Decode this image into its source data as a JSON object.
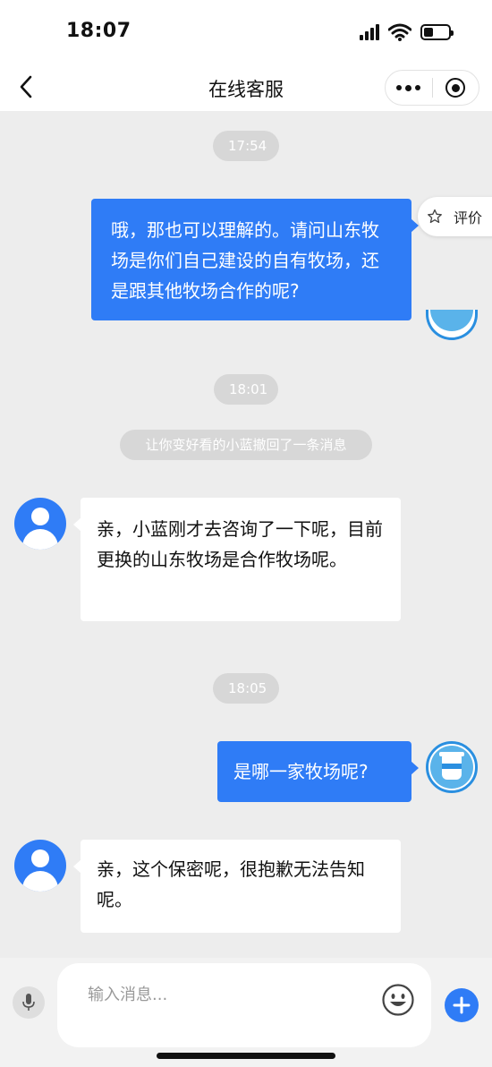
{
  "status": {
    "time": "18:07"
  },
  "nav": {
    "title": "在线客服"
  },
  "rate": {
    "label": "评价"
  },
  "messages": {
    "t1": "17:54",
    "m1": "哦，那也可以理解的。请问山东牧场是你们自己建设的自有牧场，还是跟其他牧场合作的呢?",
    "t2": "18:01",
    "notice": "让你变好看的小蓝撤回了一条消息",
    "m2": "亲，小蓝刚才去咨询了一下呢，目前更换的山东牧场是合作牧场呢。",
    "t3": "18:05",
    "m3": "是哪一家牧场呢?",
    "m4": "亲，这个保密呢，很抱歉无法告知呢。"
  },
  "input": {
    "placeholder": "输入消息..."
  },
  "colors": {
    "accent": "#2f7cf6",
    "background": "#ededed"
  }
}
